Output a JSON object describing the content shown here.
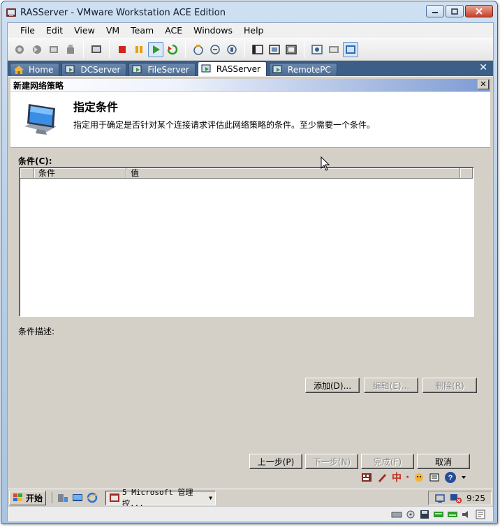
{
  "window": {
    "title": "RASServer - VMware Workstation ACE Edition"
  },
  "menu": [
    "File",
    "Edit",
    "View",
    "VM",
    "Team",
    "ACE",
    "Windows",
    "Help"
  ],
  "toolbar_icons": [
    "snapshot-icon",
    "revert-icon",
    "snapshot-manager-icon",
    "removable-icon",
    "capture-icon",
    "stop-icon",
    "pause-icon",
    "play-icon",
    "reset-icon",
    "clone-icon",
    "team-icon",
    "network-icon",
    "quick-switch-icon",
    "fullscreen-icon",
    "unity-icon",
    "summary-icon",
    "console-icon",
    "view-icon"
  ],
  "tabs": [
    {
      "label": "Home",
      "icon": "home-icon",
      "active": false
    },
    {
      "label": "DCServer",
      "icon": "vm-icon",
      "active": false
    },
    {
      "label": "FileServer",
      "icon": "vm-icon",
      "active": false
    },
    {
      "label": "RASServer",
      "icon": "vm-icon",
      "active": true
    },
    {
      "label": "RemotePC",
      "icon": "vm-icon",
      "active": false
    }
  ],
  "dialog": {
    "title": "新建网络策略",
    "header_title": "指定条件",
    "header_desc": "指定用于确定是否针对某个连接请求评估此网络策略的条件。至少需要一个条件。",
    "conditions_label": "条件(C):",
    "columns": [
      "条件",
      "值"
    ],
    "conditions_rows": [],
    "description_label": "条件描述:",
    "add_button": "添加(D)...",
    "edit_button": "编辑(E)...",
    "delete_button": "删除(R)",
    "back_button": "上一步(P)",
    "next_button": "下一步(N)",
    "finish_button": "完成(F)",
    "cancel_button": "取消"
  },
  "guest_taskbar": {
    "start_label": "开始",
    "task_label": "5 Microsoft 管理控...",
    "ime_label": "中",
    "clock": "9:25"
  }
}
